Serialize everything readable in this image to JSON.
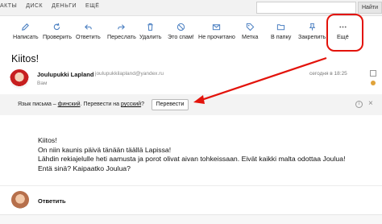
{
  "topnav": {
    "items": [
      "АКТЫ",
      "ДИСК",
      "ДЕНЬГИ",
      "ЕЩЁ"
    ],
    "search_button": "Найти"
  },
  "toolbar": {
    "buttons": [
      {
        "label": "Написать",
        "icon": "pencil-icon"
      },
      {
        "label": "Проверить",
        "icon": "refresh-icon"
      },
      {
        "label": "Ответить",
        "icon": "reply-icon"
      },
      {
        "label": "Переслать",
        "icon": "forward-icon"
      },
      {
        "label": "Удалить",
        "icon": "trash-icon"
      },
      {
        "label": "Это спам!",
        "icon": "spam-icon"
      },
      {
        "label": "Не прочитано",
        "icon": "envelope-icon"
      },
      {
        "label": "Метка",
        "icon": "tag-icon"
      },
      {
        "label": "В папку",
        "icon": "folder-icon"
      },
      {
        "label": "Закрепить",
        "icon": "pin-icon"
      },
      {
        "label": "Ещё",
        "icon": "more-dots-icon"
      }
    ]
  },
  "message": {
    "subject": "Kiitos!",
    "sender_name": "Joulupukki Lapland",
    "sender_email": "joulupukkilapland@yandex.ru",
    "recipient": "Вам",
    "date": "сегодня в 18:25",
    "body": [
      "Kiitos!",
      "On niin kaunis päivä tänään täällä Lapissa!",
      "Lähdin rekiajelulle heti aamusta ja porot olivat aivan tohkeissaan. Eivät kaikki malta odottaa Joulua!",
      "Entä sinä? Kaipaatko Joulua?"
    ]
  },
  "translate": {
    "prefix": "Язык письма – ",
    "language": "финский",
    "middle": ". Перевести на ",
    "target": "русский",
    "suffix": "?",
    "button": "Перевести",
    "close": "×",
    "info": "i"
  },
  "reply": {
    "label": "Ответить"
  },
  "colors": {
    "accent_red": "#e3130b"
  }
}
